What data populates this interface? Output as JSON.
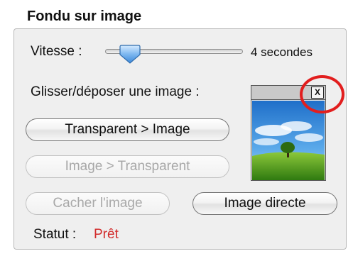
{
  "panel": {
    "title": "Fondu sur image"
  },
  "speed": {
    "label": "Vitesse :",
    "value_text": "4 secondes",
    "slider_fraction": 0.12
  },
  "drop": {
    "label": "Glisser/déposer une image :",
    "close_label": "X"
  },
  "buttons": {
    "transparent_to_image": "Transparent > Image",
    "image_to_transparent": "Image > Transparent",
    "hide_image": "Cacher l'image",
    "direct_image": "Image directe"
  },
  "status": {
    "label": "Statut :",
    "value": "Prêt"
  },
  "colors": {
    "status_value": "#d22b2b",
    "highlight": "#e21e1e",
    "sky": "#3e8fd8",
    "grass": "#4f9a1d"
  }
}
